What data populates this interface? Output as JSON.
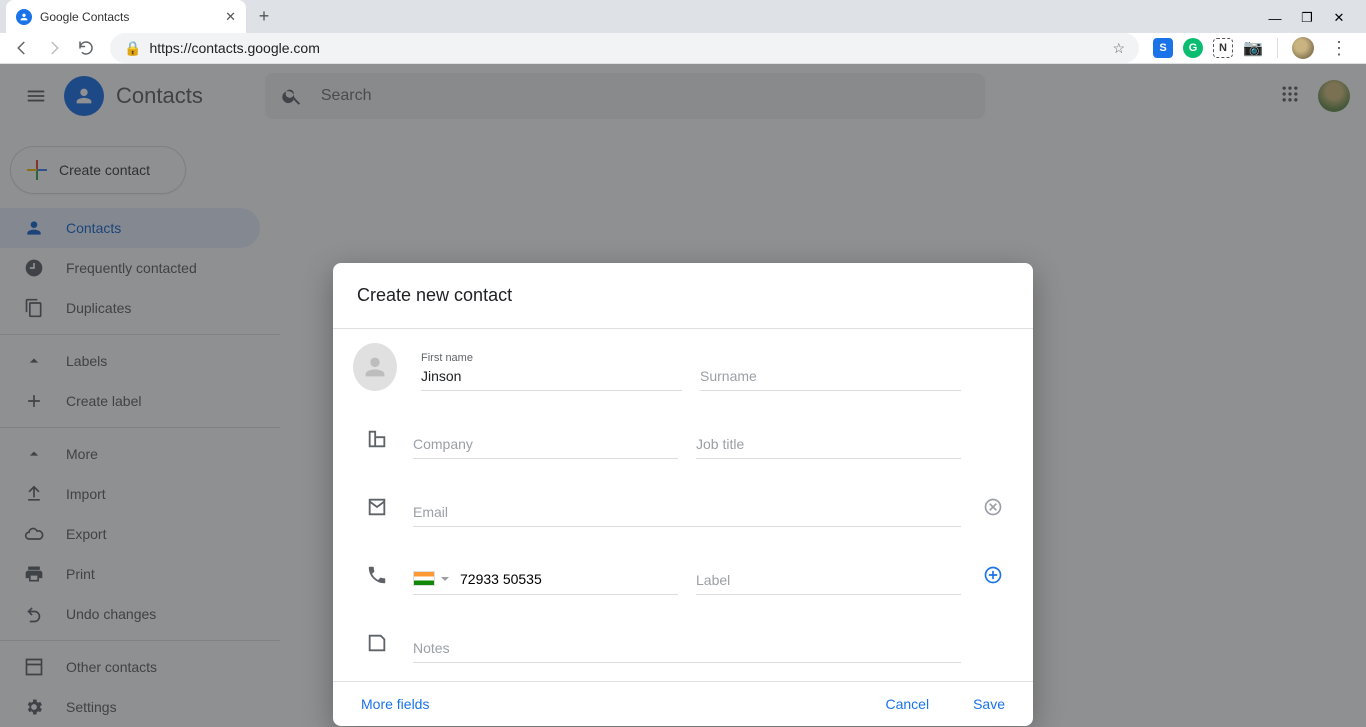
{
  "browser": {
    "tab_title": "Google Contacts",
    "url": "https://contacts.google.com"
  },
  "app": {
    "title": "Contacts",
    "search_placeholder": "Search"
  },
  "sidebar": {
    "create_label": "Create contact",
    "items": [
      {
        "label": "Contacts"
      },
      {
        "label": "Frequently contacted"
      },
      {
        "label": "Duplicates"
      }
    ],
    "labels_header": "Labels",
    "create_label_label": "Create label",
    "more": "More",
    "import": "Import",
    "export": "Export",
    "print": "Print",
    "undo": "Undo changes",
    "other": "Other contacts",
    "settings": "Settings"
  },
  "modal": {
    "title": "Create new contact",
    "first_name_label": "First name",
    "first_name_value": "Jinson",
    "surname_placeholder": "Surname",
    "company_placeholder": "Company",
    "jobtitle_placeholder": "Job title",
    "email_placeholder": "Email",
    "phone_value": "72933 50535",
    "phone_label_placeholder": "Label",
    "notes_placeholder": "Notes",
    "more_fields": "More fields",
    "cancel": "Cancel",
    "save": "Save"
  }
}
